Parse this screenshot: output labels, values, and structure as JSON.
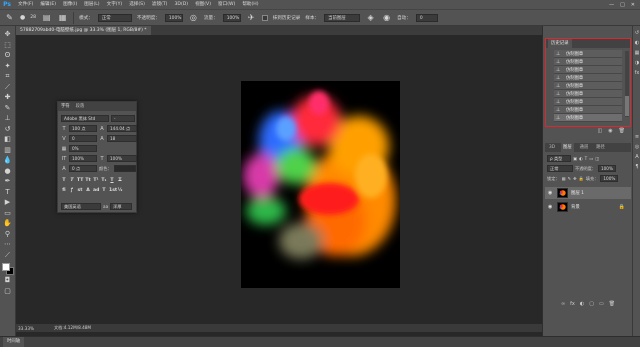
{
  "app": {
    "logo": "Ps"
  },
  "menu": [
    "文件(F)",
    "编辑(E)",
    "图像(I)",
    "图层(L)",
    "文字(Y)",
    "选择(S)",
    "滤镜(T)",
    "3D(D)",
    "视图(V)",
    "窗口(W)",
    "帮助(H)"
  ],
  "window_controls": [
    "—",
    "□",
    "✕"
  ],
  "options": {
    "brush_size": "28",
    "mode_label": "模式：",
    "mode_value": "正常",
    "opacity_label": "不透明度：",
    "opacity_value": "100%",
    "flow_label": "流量：",
    "flow_value": "100%",
    "erase_history_label": "抹到历史记录",
    "sample_label": "样本：",
    "sample_value": "当前图层",
    "auto_label": "自动：",
    "auto_value": "0"
  },
  "document_tab": "57882709abd0-电脑壁纸.jpg @ 33.3% (图层 1, RGB/8#) *",
  "character_panel": {
    "tabs": [
      "字符",
      "段落"
    ],
    "font_family": "Adobe 黑体 Std",
    "font_style": "-",
    "font_size": "100 点",
    "leading": "144.04 点",
    "kerning": "0",
    "tracking": "18",
    "scale_percent": "0%",
    "vertical_scale": "100%",
    "horizontal_scale": "100%",
    "baseline": "0 点",
    "color_label": "颜色：",
    "style_buttons": [
      "T",
      "T",
      "TT",
      "Tt",
      "T¹",
      "T₁",
      "T",
      "T"
    ],
    "extra_buttons": [
      "fi",
      "ꝭ",
      "st",
      "A",
      "ad",
      "T",
      "1st",
      "½"
    ],
    "language": "美国英语",
    "aa_label": "aa",
    "antialias": "浑厚"
  },
  "history_panel": {
    "tab_label": "历史记录",
    "items": [
      "仿制图章",
      "仿制图章",
      "仿制图章",
      "仿制图章",
      "仿制图章",
      "仿制图章",
      "仿制图章",
      "仿制图章",
      "仿制图章"
    ]
  },
  "layers_panel": {
    "tabs": [
      "3D",
      "图层",
      "通道",
      "路径"
    ],
    "search_label": "ρ 类型",
    "blend_mode": "正常",
    "opacity_label": "不透明度：",
    "opacity_value": "100%",
    "lock_label": "锁定：",
    "fill_label": "填充：",
    "fill_value": "100%",
    "layers": [
      {
        "name": "图层 1",
        "selected": true
      },
      {
        "name": "背景",
        "selected": false
      }
    ],
    "footer_icons": [
      "∞",
      "fx",
      "◐",
      "▢",
      "▭",
      "🗑"
    ]
  },
  "status": {
    "zoom": "33.33%",
    "doc_info": "文档:4.12M/8.48M"
  },
  "timeline_tab": "时间轴",
  "colors": {
    "foreground": "#ffffff",
    "background": "#000000",
    "history_highlight": "#e0262d"
  }
}
